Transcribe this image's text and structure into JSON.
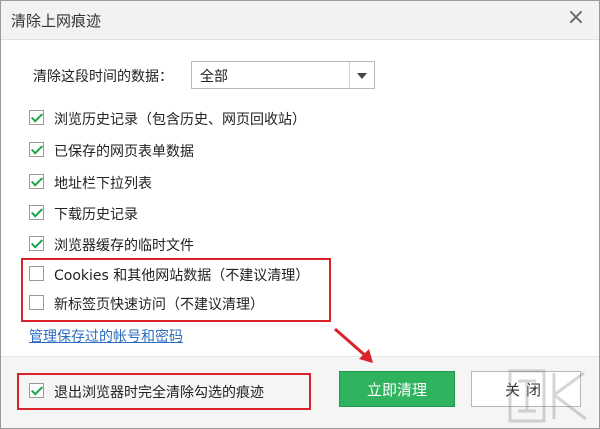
{
  "window": {
    "title": "清除上网痕迹",
    "close_icon": "close-icon"
  },
  "range": {
    "label": "清除这段时间的数据：",
    "selected": "全部"
  },
  "options": [
    {
      "label": "浏览历史记录（包含历史、网页回收站）",
      "checked": true
    },
    {
      "label": "已保存的网页表单数据",
      "checked": true
    },
    {
      "label": "地址栏下拉列表",
      "checked": true
    },
    {
      "label": "下载历史记录",
      "checked": true
    },
    {
      "label": "浏览器缓存的临时文件",
      "checked": true
    },
    {
      "label": "Cookies 和其他网站数据（不建议清理）",
      "checked": false
    },
    {
      "label": "新标签页快速访问（不建议清理）",
      "checked": false
    }
  ],
  "manage_link": "管理保存过的帐号和密码",
  "footer": {
    "exit_clear_label": "退出浏览器时完全清除勾选的痕迹",
    "exit_clear_checked": true,
    "clear_now": "立即清理",
    "close": "关闭"
  },
  "colors": {
    "accent": "#2fb35e",
    "highlight": "#d9222a",
    "link": "#2b6dbf"
  }
}
